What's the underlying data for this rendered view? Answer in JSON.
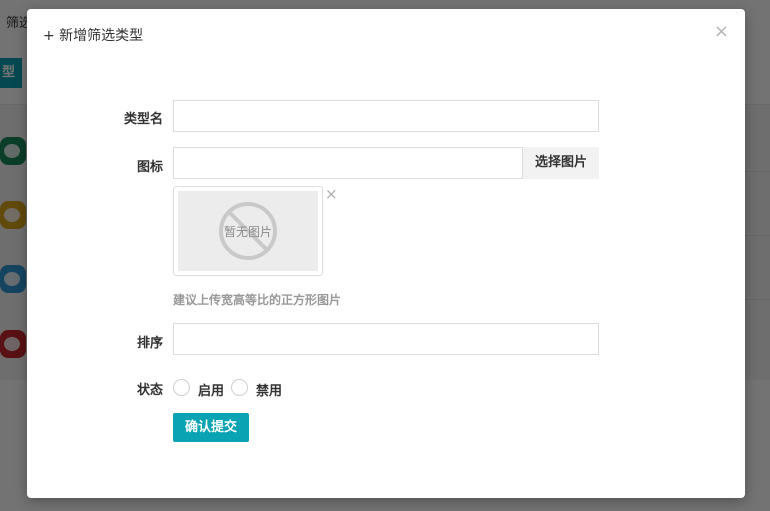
{
  "background": {
    "title": "筛选",
    "button_label": "型",
    "row_icons": [
      {
        "name": "share-icon",
        "color": "#1a8a5a"
      },
      {
        "name": "rss-icon",
        "color": "#d9a21b"
      },
      {
        "name": "twitter-icon",
        "color": "#2f97d6"
      },
      {
        "name": "weibo-icon",
        "color": "#c6262c"
      }
    ]
  },
  "modal": {
    "title": "+ 新增筛选类型",
    "close_icon": "×",
    "fields": {
      "type_name": {
        "label": "类型名",
        "value": "",
        "placeholder": ""
      },
      "icon": {
        "label": "图标",
        "value": "",
        "placeholder": "",
        "pick_button": "选择图片"
      },
      "image_placeholder_text": "暂无图片",
      "image_remove_icon": "×",
      "hint": "建议上传宽高等比的正方形图片",
      "sort": {
        "label": "排序",
        "value": "",
        "placeholder": ""
      },
      "status": {
        "label": "状态",
        "options": [
          "启用",
          "禁用"
        ],
        "selected": null
      }
    },
    "submit_label": "确认提交"
  },
  "colors": {
    "accent": "#0aa3b3",
    "overlay": "rgba(0,0,0,0.55)"
  }
}
